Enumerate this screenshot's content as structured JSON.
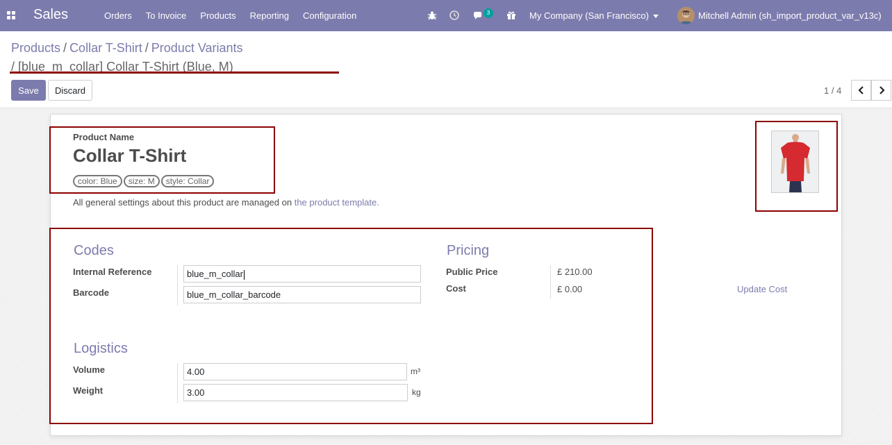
{
  "navbar": {
    "app_name": "Sales",
    "menu": [
      "Orders",
      "To Invoice",
      "Products",
      "Reporting",
      "Configuration"
    ],
    "chat_badge": "3",
    "company": "My Company (San Francisco)",
    "user": "Mitchell Admin (sh_import_product_var_v13c)",
    "icons": [
      "apps-grid-icon",
      "bug-icon",
      "clock-icon",
      "chat-icon",
      "gift-icon"
    ]
  },
  "breadcrumb": {
    "items": [
      "Products",
      "Collar T-Shirt",
      "Product Variants"
    ],
    "separator": "/",
    "current": "/ [blue_m_collar] Collar T-Shirt (Blue, M)"
  },
  "buttons": {
    "save": "Save",
    "discard": "Discard"
  },
  "pager": {
    "text": "1 / 4"
  },
  "product": {
    "name_label": "Product Name",
    "name": "Collar T-Shirt",
    "attributes": [
      "color: Blue",
      "size: M",
      "style: Collar"
    ],
    "note_prefix": "All general settings about this product are managed on",
    "note_link": "the product template."
  },
  "codes": {
    "title": "Codes",
    "internal_ref_label": "Internal Reference",
    "internal_ref": "blue_m_collar",
    "barcode_label": "Barcode",
    "barcode": "blue_m_collar_barcode"
  },
  "pricing": {
    "title": "Pricing",
    "public_price_label": "Public Price",
    "public_price": "£ 210.00",
    "cost_label": "Cost",
    "cost": "£ 0.00",
    "update_cost": "Update Cost"
  },
  "logistics": {
    "title": "Logistics",
    "volume_label": "Volume",
    "volume": "4.00",
    "volume_unit": "m³",
    "weight_label": "Weight",
    "weight": "3.00",
    "weight_unit": "kg"
  },
  "colors": {
    "brand": "#7c7bad",
    "highlight": "#8b0000",
    "shirt": "#d42a30"
  }
}
